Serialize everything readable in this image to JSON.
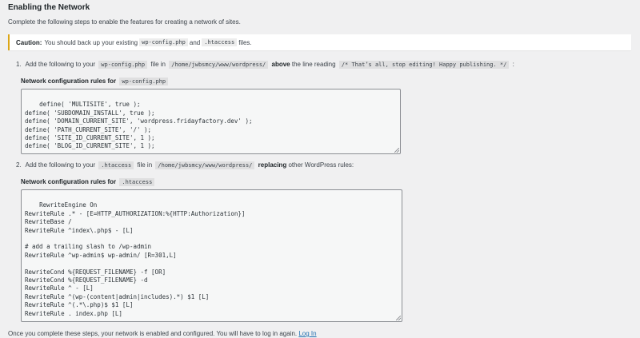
{
  "page": {
    "title": "Enabling the Network",
    "intro": "Complete the following steps to enable the features for creating a network of sites."
  },
  "caution": {
    "label": "Caution:",
    "text_before": "You should back up your existing",
    "code1": "wp-config.php",
    "text_mid": "and",
    "code2": ".htaccess",
    "text_after": "files."
  },
  "step1": {
    "number": "1.",
    "text_a": "Add the following to your",
    "code_file": "wp-config.php",
    "text_b": "file in",
    "code_path": "/home/jwbsmcy/www/wordpress/",
    "bold": "above",
    "text_c": "the line reading",
    "code_line": "/* That’s all, stop editing! Happy publishing. */",
    "text_d": ":",
    "rules_label": "Network configuration rules for",
    "rules_code": "wp-config.php",
    "textarea": "define( 'MULTISITE', true );\ndefine( 'SUBDOMAIN_INSTALL', true );\ndefine( 'DOMAIN_CURRENT_SITE', 'wordpress.fridayfactory.dev' );\ndefine( 'PATH_CURRENT_SITE', '/' );\ndefine( 'SITE_ID_CURRENT_SITE', 1 );\ndefine( 'BLOG_ID_CURRENT_SITE', 1 );"
  },
  "step2": {
    "number": "2.",
    "text_a": "Add the following to your",
    "code_file": ".htaccess",
    "text_b": "file in",
    "code_path": "/home/jwbsmcy/www/wordpress/",
    "bold": "replacing",
    "text_c": "other WordPress rules:",
    "rules_label": "Network configuration rules for",
    "rules_code": ".htaccess",
    "textarea": "RewriteEngine On\nRewriteRule .* - [E=HTTP_AUTHORIZATION:%{HTTP:Authorization}]\nRewriteBase /\nRewriteRule ^index\\.php$ - [L]\n\n# add a trailing slash to /wp-admin\nRewriteRule ^wp-admin$ wp-admin/ [R=301,L]\n\nRewriteCond %{REQUEST_FILENAME} -f [OR]\nRewriteCond %{REQUEST_FILENAME} -d\nRewriteRule ^ - [L]\nRewriteRule ^(wp-(content|admin|includes).*) $1 [L]\nRewriteRule ^(.*\\.php)$ $1 [L]\nRewriteRule . index.php [L]"
  },
  "footer": {
    "text": "Once you complete these steps, your network is enabled and configured. You will have to log in again.",
    "link": "Log In"
  }
}
